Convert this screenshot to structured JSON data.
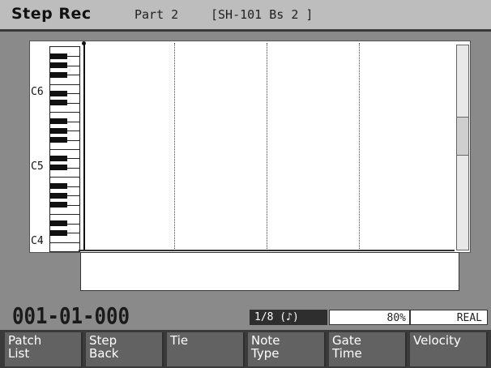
{
  "title": "Step Rec",
  "part": "Part 2",
  "patch": "[SH-101 Bs 2 ]",
  "keyboard": {
    "octave_labels": [
      "C6",
      "C5",
      "C4"
    ]
  },
  "position": "001-01-000",
  "status": {
    "note_type": "1/8 (♪)",
    "velocity": "80%",
    "mode": "REAL"
  },
  "function_buttons": [
    {
      "line1": "Patch",
      "line2": "List"
    },
    {
      "line1": "Step",
      "line2": "Back"
    },
    {
      "line1": "Tie",
      "line2": ""
    },
    {
      "line1": "Note",
      "line2": "Type"
    },
    {
      "line1": "Gate",
      "line2": "Time"
    },
    {
      "line1": "Velocity",
      "line2": ""
    }
  ]
}
